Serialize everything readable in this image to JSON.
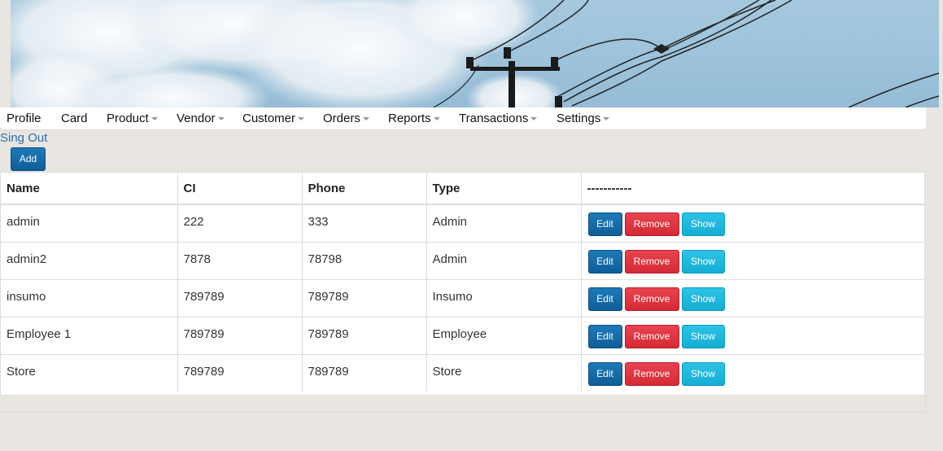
{
  "nav": {
    "items": [
      {
        "label": "Profile",
        "dropdown": false
      },
      {
        "label": "Card",
        "dropdown": false
      },
      {
        "label": "Product",
        "dropdown": true
      },
      {
        "label": "Vendor",
        "dropdown": true
      },
      {
        "label": "Customer",
        "dropdown": true
      },
      {
        "label": "Orders",
        "dropdown": true
      },
      {
        "label": "Reports",
        "dropdown": true
      },
      {
        "label": "Transactions",
        "dropdown": true
      },
      {
        "label": "Settings",
        "dropdown": true
      }
    ]
  },
  "signout_label": "Sing Out",
  "add_label": "Add",
  "table": {
    "headers": [
      "Name",
      "CI",
      "Phone",
      "Type",
      "-----------"
    ],
    "rows": [
      {
        "name": "admin",
        "ci": "222",
        "phone": "333",
        "type": "Admin"
      },
      {
        "name": "admin2",
        "ci": "7878",
        "phone": "78798",
        "type": "Admin"
      },
      {
        "name": "insumo",
        "ci": "789789",
        "phone": "789789",
        "type": "Insumo"
      },
      {
        "name": "Employee 1",
        "ci": "789789",
        "phone": "789789",
        "type": "Employee"
      },
      {
        "name": "Store",
        "ci": "789789",
        "phone": "789789",
        "type": "Store"
      }
    ],
    "actions": {
      "edit": "Edit",
      "remove": "Remove",
      "show": "Show"
    }
  },
  "colors": {
    "primary": "#1470ad",
    "danger": "#dc3545",
    "info": "#1fb6dc",
    "link": "#2a6fb0",
    "page_bg": "#e9e6e1"
  }
}
